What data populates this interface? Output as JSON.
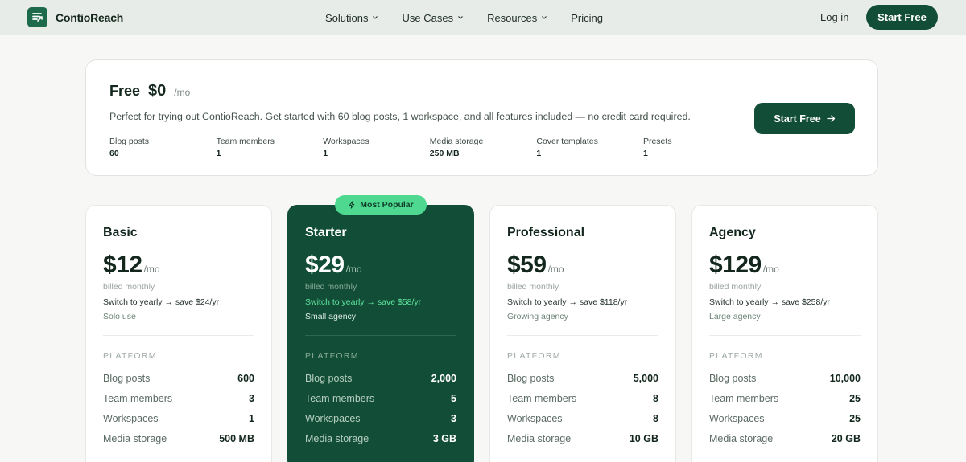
{
  "brand": {
    "name": "ContioReach"
  },
  "nav": {
    "links": [
      {
        "label": "Solutions",
        "dropdown": true
      },
      {
        "label": "Use Cases",
        "dropdown": true
      },
      {
        "label": "Resources",
        "dropdown": true
      },
      {
        "label": "Pricing",
        "dropdown": false
      }
    ],
    "login": "Log in",
    "cta": "Start Free"
  },
  "free_plan": {
    "name": "Free",
    "price": "$0",
    "unit": "/mo",
    "description": "Perfect for trying out ContioReach. Get started with 60 blog posts, 1 workspace, and all features included — no credit card required.",
    "stats": [
      {
        "label": "Blog posts",
        "value": "60"
      },
      {
        "label": "Team members",
        "value": "1"
      },
      {
        "label": "Workspaces",
        "value": "1"
      },
      {
        "label": "Media storage",
        "value": "250 MB"
      },
      {
        "label": "Cover templates",
        "value": "1"
      },
      {
        "label": "Presets",
        "value": "1"
      }
    ],
    "cta": "Start Free"
  },
  "badge": {
    "label": "Most Popular"
  },
  "section_label": "PLATFORM",
  "plans": [
    {
      "name": "Basic",
      "price": "$12",
      "unit": "/mo",
      "billed": "billed monthly",
      "yearly": "Switch to yearly → save $24/yr",
      "audience": "Solo use",
      "rows": [
        {
          "k": "Blog posts",
          "v": "600"
        },
        {
          "k": "Team members",
          "v": "3"
        },
        {
          "k": "Workspaces",
          "v": "1"
        },
        {
          "k": "Media storage",
          "v": "500 MB"
        }
      ]
    },
    {
      "name": "Starter",
      "price": "$29",
      "unit": "/mo",
      "billed": "billed monthly",
      "yearly": "Switch to yearly → save $58/yr",
      "audience": "Small agency",
      "rows": [
        {
          "k": "Blog posts",
          "v": "2,000"
        },
        {
          "k": "Team members",
          "v": "5"
        },
        {
          "k": "Workspaces",
          "v": "3"
        },
        {
          "k": "Media storage",
          "v": "3 GB"
        }
      ]
    },
    {
      "name": "Professional",
      "price": "$59",
      "unit": "/mo",
      "billed": "billed monthly",
      "yearly": "Switch to yearly → save $118/yr",
      "audience": "Growing agency",
      "rows": [
        {
          "k": "Blog posts",
          "v": "5,000"
        },
        {
          "k": "Team members",
          "v": "8"
        },
        {
          "k": "Workspaces",
          "v": "8"
        },
        {
          "k": "Media storage",
          "v": "10 GB"
        }
      ]
    },
    {
      "name": "Agency",
      "price": "$129",
      "unit": "/mo",
      "billed": "billed monthly",
      "yearly": "Switch to yearly → save $258/yr",
      "audience": "Large agency",
      "rows": [
        {
          "k": "Blog posts",
          "v": "10,000"
        },
        {
          "k": "Team members",
          "v": "25"
        },
        {
          "k": "Workspaces",
          "v": "25"
        },
        {
          "k": "Media storage",
          "v": "20 GB"
        }
      ]
    }
  ],
  "colors": {
    "brand_dark": "#124d37",
    "accent_green": "#4fd88f",
    "yearly_highlight": "#5fe6a0"
  },
  "icons": {
    "logo": "logo-mark-icon",
    "dropdown": "chevron-down-icon",
    "arrow": "arrow-right-icon",
    "badge": "lightning-icon"
  }
}
